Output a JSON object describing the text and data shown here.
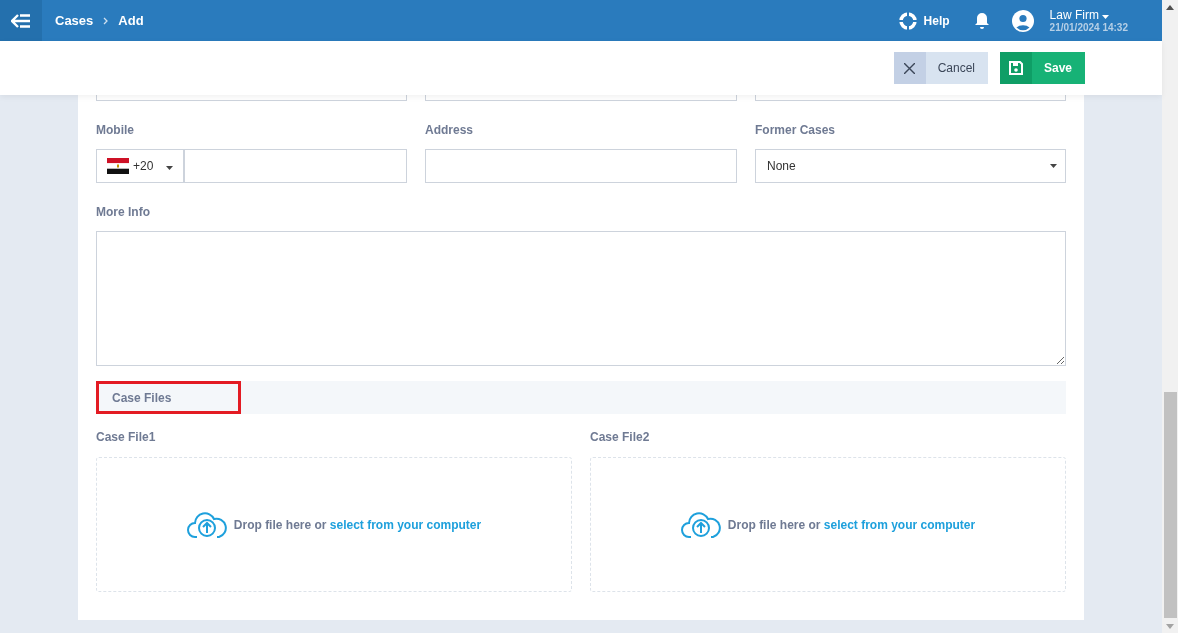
{
  "header": {
    "breadcrumb": [
      "Cases",
      "Add"
    ],
    "help": "Help",
    "user": {
      "name": "Law Firm",
      "date": "21/01/2024 14:32"
    }
  },
  "toolbar": {
    "cancel": "Cancel",
    "save": "Save"
  },
  "fields": [
    {
      "kind": "phone",
      "label": "Mobile",
      "code": "+20"
    },
    {
      "kind": "text",
      "label": "Address"
    },
    {
      "kind": "select",
      "label": "Former Cases",
      "value": "None"
    }
  ],
  "more_info": {
    "label": "More Info"
  },
  "section": {
    "title": "Case Files",
    "highlighted": true
  },
  "files": [
    {
      "label": "Case File1",
      "text": "Drop file here or",
      "link": "select from your computer"
    },
    {
      "label": "Case File2",
      "text": "Drop file here or",
      "link": "select from your computer"
    }
  ]
}
